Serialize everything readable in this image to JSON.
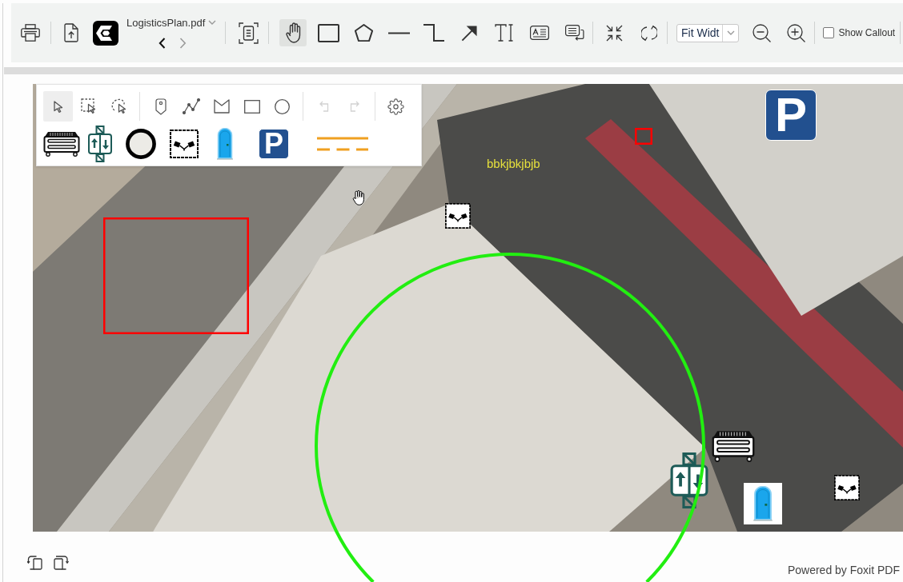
{
  "toolbar": {
    "file": {
      "name": "LogisticsPlan.pdf"
    },
    "page_nav": [
      {
        "kind": "prev",
        "disabled": false
      },
      {
        "kind": "next",
        "disabled": true
      }
    ],
    "tools": [
      {
        "kind": "hand",
        "selected": true
      },
      {
        "kind": "rectangle",
        "selected": false
      },
      {
        "kind": "polygon",
        "selected": false
      },
      {
        "kind": "line",
        "selected": false
      },
      {
        "kind": "polyline",
        "selected": false
      },
      {
        "kind": "arrow",
        "selected": false
      },
      {
        "kind": "text",
        "selected": false
      },
      {
        "kind": "textbox",
        "selected": false
      },
      {
        "kind": "callout",
        "selected": false
      }
    ],
    "zoom": {
      "value": "Fit Widt"
    },
    "show_callout": {
      "label": "Show Callout",
      "checked": false
    }
  },
  "palette": {
    "select_tools": [
      {
        "kind": "pointer",
        "selected": true
      },
      {
        "kind": "marquee",
        "selected": false
      },
      {
        "kind": "lasso",
        "selected": false
      }
    ],
    "draw_tools": [
      {
        "kind": "pin",
        "selected": false
      },
      {
        "kind": "polyline",
        "selected": false
      },
      {
        "kind": "polygon",
        "selected": false
      },
      {
        "kind": "rectangle",
        "selected": false
      },
      {
        "kind": "ellipse",
        "selected": false
      }
    ],
    "history": [
      {
        "kind": "undo",
        "disabled": true
      },
      {
        "kind": "redo",
        "disabled": true
      }
    ],
    "stamps": [
      {
        "kind": "dumpster"
      },
      {
        "kind": "elevator"
      },
      {
        "kind": "ring"
      },
      {
        "kind": "flags"
      },
      {
        "kind": "toilet"
      },
      {
        "kind": "parking",
        "label": "P"
      },
      {
        "kind": "lines"
      }
    ]
  },
  "page": {
    "markups": [
      {
        "kind": "rectangle",
        "color": "#ff0000"
      },
      {
        "kind": "rectangle",
        "color": "#ff0000"
      },
      {
        "kind": "text",
        "text": "bbkjbkjbjb",
        "color": "#e6e03c"
      },
      {
        "kind": "ellipse",
        "color": "#22ee11"
      }
    ],
    "stamps": [
      {
        "kind": "flags"
      },
      {
        "kind": "parking",
        "label": "P"
      },
      {
        "kind": "dumpster"
      },
      {
        "kind": "elevator"
      },
      {
        "kind": "toilet"
      },
      {
        "kind": "flags"
      }
    ]
  },
  "footer": {
    "credit": "Powered by Foxit PDF"
  }
}
